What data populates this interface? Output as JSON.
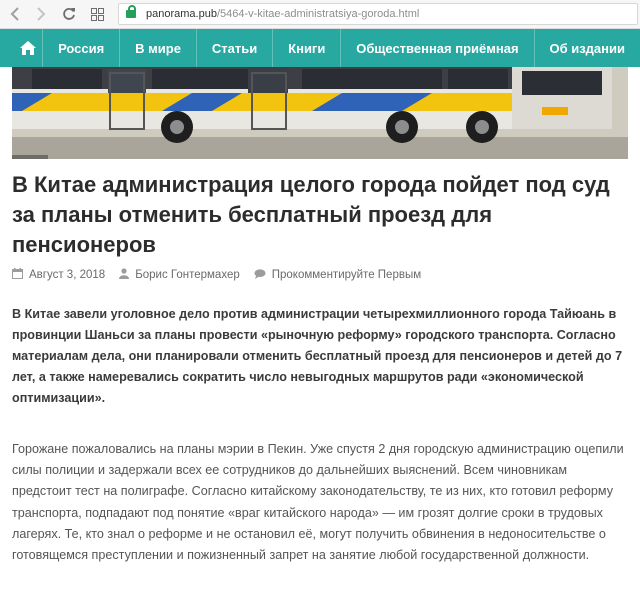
{
  "browser": {
    "url_domain": "panorama.pub",
    "url_path": "/5464-v-kitae-administratsiya-goroda.html",
    "icons": [
      "back-arrow-icon",
      "forward-arrow-icon",
      "reload-icon",
      "apps-grid-icon",
      "lock-icon"
    ]
  },
  "nav": {
    "items": [
      "Россия",
      "В мире",
      "Статьи",
      "Книги",
      "Общественная приёмная",
      "Об издании"
    ],
    "bg_color": "#27a8a1"
  },
  "article": {
    "title": "В Китае администрация целого города пойдет под суд за планы отменить бесплатный проезд для пенсионеров",
    "date": "Август 3, 2018",
    "author": "Борис Гонтермахер",
    "comment_link": "Прокомментируйте Первым",
    "lead": "В Китае завели уголовное дело против администрации четырехмиллионного города Тайюань в провинции Шаньси за планы провести «рыночную реформу» городского транспорта. Согласно материалам дела, они планировали отменить бесплатный проезд для пенсионеров и детей до 7 лет, а также намеревались сократить число невыгодных маршрутов ради «экономической оптимизации».",
    "body": "Горожане пожаловались на планы мэрии в Пекин. Уже спустя 2 дня городскую администрацию оцепили силы полиции и задержали всех ее сотрудников до дальнейших выяснений. Всем чиновникам предстоит тест на полиграфе. Согласно китайскому законодательству, те из них, кто готовил реформу транспорта, подпадают под понятие «враг китайского народа» — им грозят долгие сроки в трудовых лагерях. Те, кто знал о реформе и не остановил её, могут получить обвинения в недоносительстве о готовящемся преступлении и пожизненный запрет на занятие любой государственной должности."
  }
}
